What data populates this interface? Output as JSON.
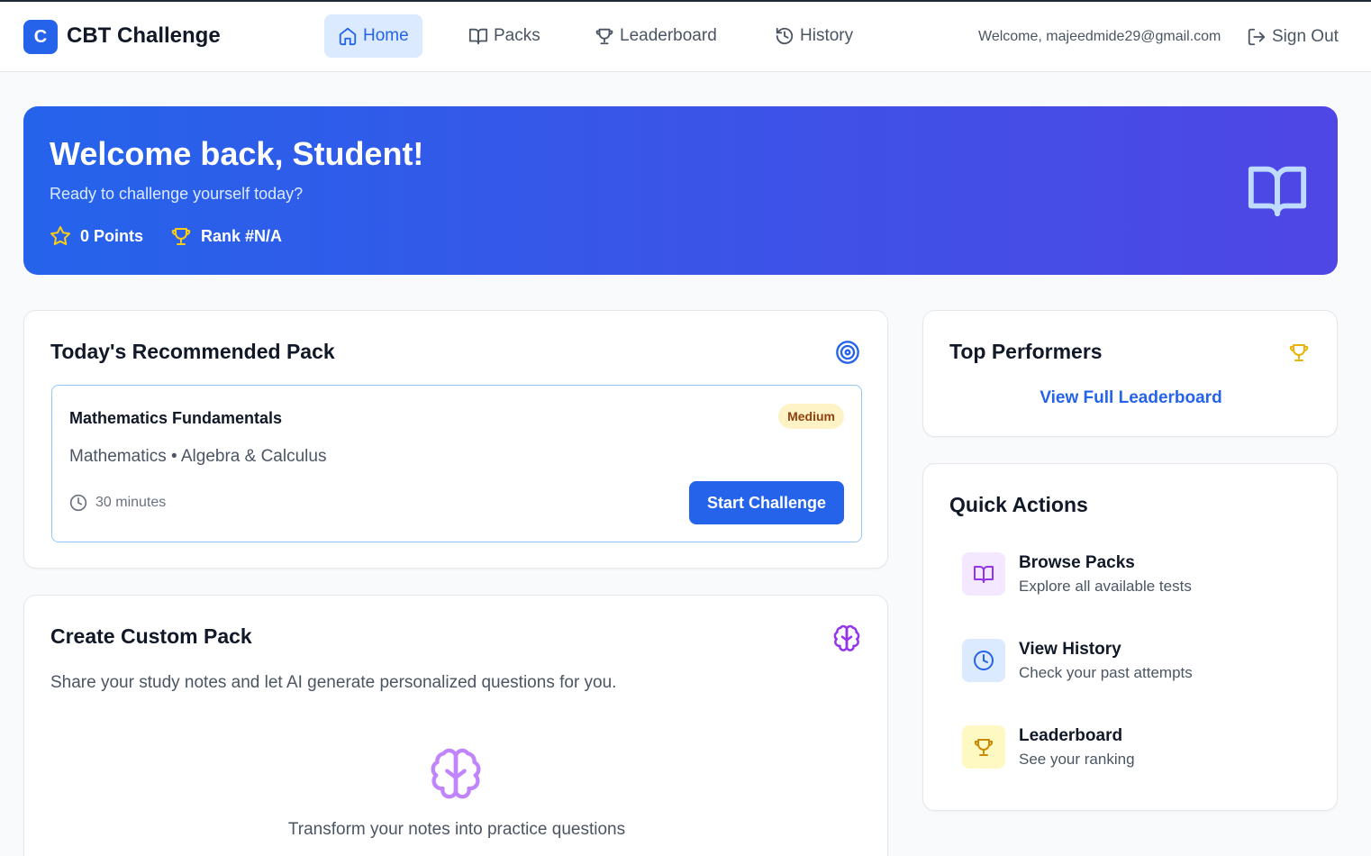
{
  "header": {
    "logo_letter": "C",
    "brand": "CBT Challenge",
    "nav": [
      {
        "label": "Home",
        "icon": "home-icon",
        "active": true
      },
      {
        "label": "Packs",
        "icon": "book-icon",
        "active": false
      },
      {
        "label": "Leaderboard",
        "icon": "trophy-icon",
        "active": false
      },
      {
        "label": "History",
        "icon": "history-icon",
        "active": false
      }
    ],
    "welcome_text": "Welcome, majeedmide29@gmail.com",
    "signout_label": "Sign Out"
  },
  "hero": {
    "title": "Welcome back, Student!",
    "subtitle": "Ready to challenge yourself today?",
    "points": "0 Points",
    "rank": "Rank #N/A"
  },
  "recommended": {
    "title": "Today's Recommended Pack",
    "pack_name": "Mathematics Fundamentals",
    "difficulty": "Medium",
    "meta": "Mathematics • Algebra & Calculus",
    "duration": "30 minutes",
    "start_label": "Start Challenge"
  },
  "custom": {
    "title": "Create Custom Pack",
    "description": "Share your study notes and let AI generate personalized questions for you.",
    "cta": "Transform your notes into practice questions"
  },
  "top_performers": {
    "title": "Top Performers",
    "link": "View Full Leaderboard"
  },
  "quick_actions": {
    "title": "Quick Actions",
    "items": [
      {
        "title": "Browse Packs",
        "subtitle": "Explore all available tests",
        "icon": "book-icon",
        "bg": "#f3e8ff",
        "color": "#9333ea"
      },
      {
        "title": "View History",
        "subtitle": "Check your past attempts",
        "icon": "clock-icon",
        "bg": "#dbeafe",
        "color": "#2563eb"
      },
      {
        "title": "Leaderboard",
        "subtitle": "See your ranking",
        "icon": "trophy-icon",
        "bg": "#fef9c3",
        "color": "#ca8a04"
      }
    ]
  },
  "colors": {
    "primary": "#2563eb",
    "hero_gradient_end": "#4f46e5",
    "star_gold": "#facc15",
    "purple": "#9333ea"
  }
}
